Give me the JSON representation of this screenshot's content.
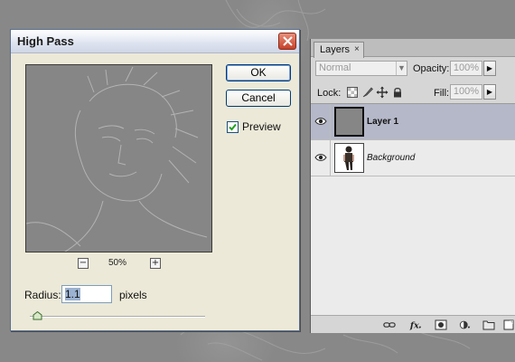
{
  "dialog": {
    "title": "High Pass",
    "ok_label": "OK",
    "cancel_label": "Cancel",
    "preview_label": "Preview",
    "preview_checked": true,
    "zoom_minus": "−",
    "zoom_plus": "+",
    "zoom_level": "50%",
    "radius_label": "Radius:",
    "radius_value": "1.1",
    "radius_unit": "pixels",
    "icons": {
      "close": "close-icon",
      "checkbox": "check-icon",
      "slider": "slider-thumb-icon"
    }
  },
  "layers": {
    "tab_label": "Layers",
    "tab_close": "×",
    "blend_mode": "Normal",
    "opacity_label": "Opacity:",
    "opacity_value": "100%",
    "lock_label": "Lock:",
    "fill_label": "Fill:",
    "fill_value": "100%",
    "items": [
      {
        "name": "Layer 1",
        "selected": true,
        "visible": true
      },
      {
        "name": "Background",
        "selected": false,
        "visible": true
      }
    ],
    "footer_icons": [
      "link-layers-icon",
      "fx-icon",
      "add-mask-icon",
      "adjustment-layer-icon",
      "new-group-icon",
      "new-layer-icon"
    ]
  },
  "colors": {
    "workspace": "#888888",
    "dialog_bg": "#ece9d8",
    "selected_layer": "#b5b8c8",
    "close_button": "#c6422a"
  }
}
